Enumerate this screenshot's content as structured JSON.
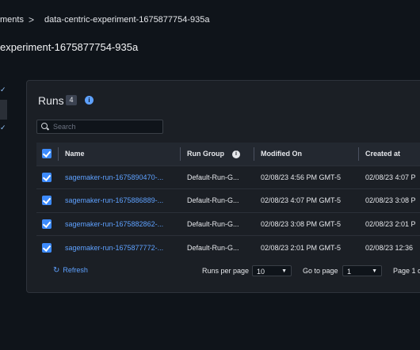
{
  "breadcrumb": {
    "items": [
      "ments",
      "data-centric-experiment-1675877754-935a"
    ],
    "separator": ">"
  },
  "page_title": "experiment-1675877754-935a",
  "runs_panel": {
    "title": "Runs",
    "count": "4",
    "search_placeholder": "Search",
    "columns": [
      "Name",
      "Run Group",
      "Modified On",
      "Created at"
    ],
    "rows": [
      {
        "name": "sagemaker-run-1675890470-...",
        "run_group": "Default-Run-G...",
        "modified_on": "02/08/23 4:56 PM GMT-5",
        "created_at": "02/08/23 4:07 P"
      },
      {
        "name": "sagemaker-run-1675886889-...",
        "run_group": "Default-Run-G...",
        "modified_on": "02/08/23 4:07 PM GMT-5",
        "created_at": "02/08/23 3:08 P"
      },
      {
        "name": "sagemaker-run-1675882862-...",
        "run_group": "Default-Run-G...",
        "modified_on": "02/08/23 3:08 PM GMT-5",
        "created_at": "02/08/23 2:01 P"
      },
      {
        "name": "sagemaker-run-1675877772-...",
        "run_group": "Default-Run-G...",
        "modified_on": "02/08/23 2:01 PM GMT-5",
        "created_at": "02/08/23 12:36"
      }
    ],
    "footer": {
      "refresh_label": "Refresh",
      "rows_per_page_label": "Runs per page",
      "rows_per_page_value": "10",
      "go_to_page_label": "Go to page",
      "go_to_page_value": "1",
      "page_of_label": "Page 1 o"
    }
  },
  "colors": {
    "background": "#0f141a",
    "panel": "#1b1f25",
    "accent": "#5ea1ff",
    "checkbox": "#3d8bfd"
  }
}
